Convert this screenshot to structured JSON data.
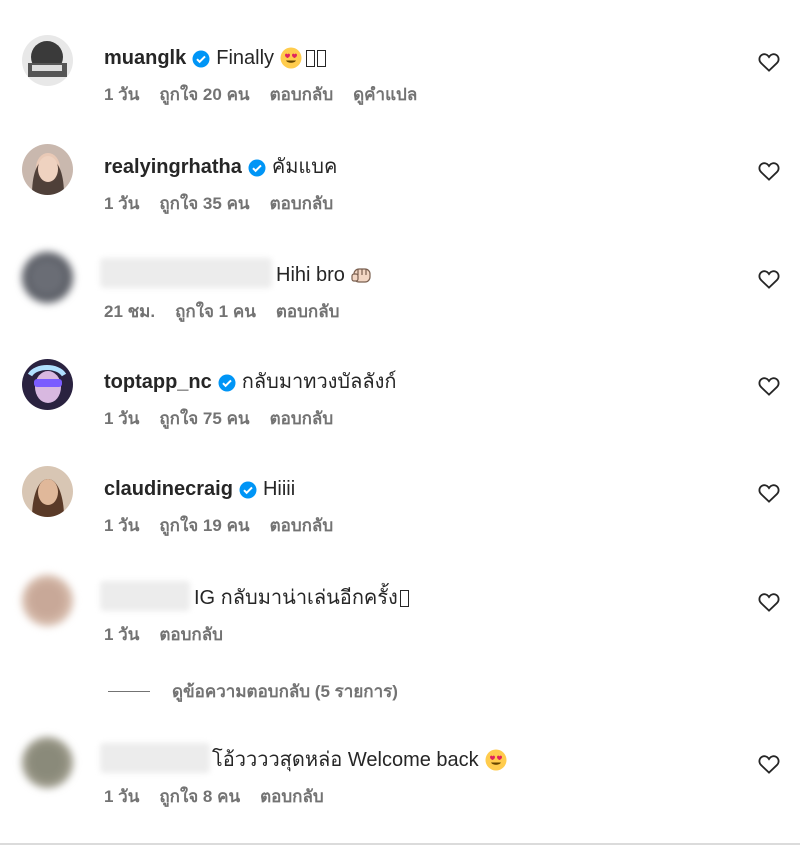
{
  "comments": [
    {
      "username": "muanglk",
      "verified": true,
      "text": "Finally",
      "emoji": "heart-eyes",
      "trailing_tofu": 2,
      "time": "1 วัน",
      "likes": "ถูกใจ 20 คน",
      "reply": "ตอบกลับ",
      "translate": "ดูคำแปล",
      "avatar_color": "#3a3a3a"
    },
    {
      "username": "realyingrhatha",
      "verified": true,
      "text": "คัมแบค",
      "time": "1 วัน",
      "likes": "ถูกใจ 35 คน",
      "reply": "ตอบกลับ",
      "avatar_color": "#5a4540"
    },
    {
      "username": "",
      "blurred": true,
      "text": "Hihi bro",
      "emoji": "fist-bump",
      "time": "21 ชม.",
      "likes": "ถูกใจ 1 คน",
      "reply": "ตอบกลับ",
      "avatar_color": "#5b5e66"
    },
    {
      "username": "toptapp_nc",
      "verified": true,
      "text": "กลับมาทวงบัลลังก์",
      "time": "1 วัน",
      "likes": "ถูกใจ 75 คน",
      "reply": "ตอบกลับ",
      "avatar_color": "#6a4fc4"
    },
    {
      "username": "claudinecraig",
      "verified": true,
      "text": "Hiiii",
      "time": "1 วัน",
      "likes": "ถูกใจ 19 คน",
      "reply": "ตอบกลับ",
      "avatar_color": "#7a5440"
    },
    {
      "username": "",
      "blurred": true,
      "text": "IG กลับมาน่าเล่นอีกครั้ง",
      "trailing_tofu": 1,
      "time": "1 วัน",
      "reply": "ตอบกลับ",
      "avatar_color": "#c8a898"
    },
    {
      "username": "",
      "blurred": true,
      "text": "โอ้ววววสุดหล่อ Welcome back",
      "emoji": "heart-eyes",
      "time": "1 วัน",
      "likes": "ถูกใจ 8 คน",
      "reply": "ตอบกลับ",
      "avatar_color": "#8a8a7a"
    }
  ],
  "view_replies_label": "ดูข้อความตอบกลับ (5 รายการ)",
  "colors": {
    "text": "#262626",
    "secondary": "#737373",
    "verified": "#0095f6"
  },
  "icons": {
    "verified": "verified-badge-icon",
    "like": "heart-outline-icon"
  }
}
